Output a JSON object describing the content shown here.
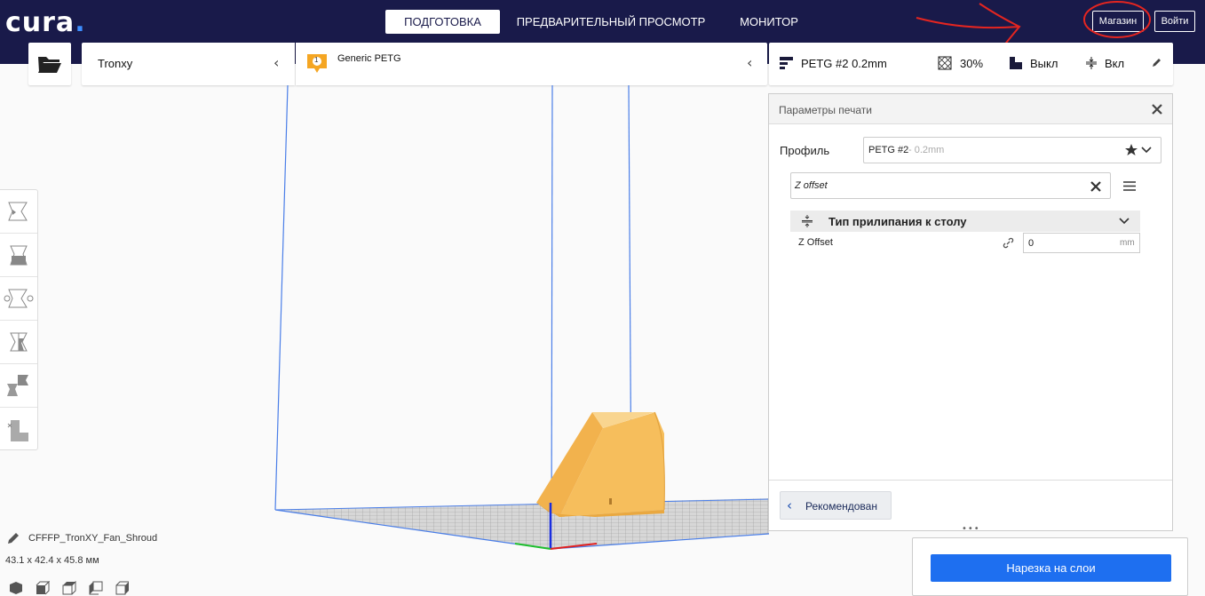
{
  "app": {
    "logo_text": "cura",
    "logo_dot": "."
  },
  "nav": {
    "tabs": [
      {
        "label": "ПОДГОТОВКА",
        "active": true
      },
      {
        "label": "ПРЕДВАРИТЕЛЬНЫЙ ПРОСМОТР",
        "active": false
      },
      {
        "label": "МОНИТОР",
        "active": false
      }
    ],
    "marketplace_label": "Магазин",
    "signin_label": "Войти"
  },
  "printer": {
    "name": "Tronxy"
  },
  "material": {
    "badge": "1",
    "name": "Generic PETG",
    "badge_color": "#f5a623"
  },
  "settings_summary": {
    "profile": "PETG #2 0.2mm",
    "infill": "30%",
    "support": "Выкл",
    "adhesion": "Вкл"
  },
  "print_settings": {
    "title": "Параметры печати",
    "profile_label": "Профиль",
    "profile_name": "PETG #2",
    "profile_layer": " - 0.2mm",
    "search_value": "Z offset",
    "category_label": "Тип прилипания к столу",
    "setting_label": "Z Offset",
    "setting_value": "0",
    "setting_unit": "mm",
    "recommended_label": "Рекомендован"
  },
  "model": {
    "name": "CFFFP_TronXY_Fan_Shroud",
    "dimensions": "43.1 x 42.4 x 45.8 мм"
  },
  "slice": {
    "label": "Нарезка на слои"
  },
  "icons": [
    "open-folder-icon",
    "chevron-left-icon",
    "profile-icon",
    "infill-icon",
    "support-icon",
    "adhesion-icon",
    "pencil-icon",
    "close-icon",
    "star-icon",
    "chevron-down-icon",
    "clear-icon",
    "menu-icon",
    "adhesion-category-icon",
    "link-icon",
    "move-tool-icon",
    "scale-tool-icon",
    "rotate-tool-icon",
    "mirror-tool-icon",
    "per-model-settings-icon",
    "support-blocker-icon",
    "view-3d-icon",
    "view-front-icon",
    "view-top-icon",
    "view-left-icon",
    "view-right-icon"
  ],
  "colors": {
    "topbar": "#191a4a",
    "accent": "#1e6ff0",
    "model": "#f6be5c",
    "annotation": "#e52520"
  }
}
